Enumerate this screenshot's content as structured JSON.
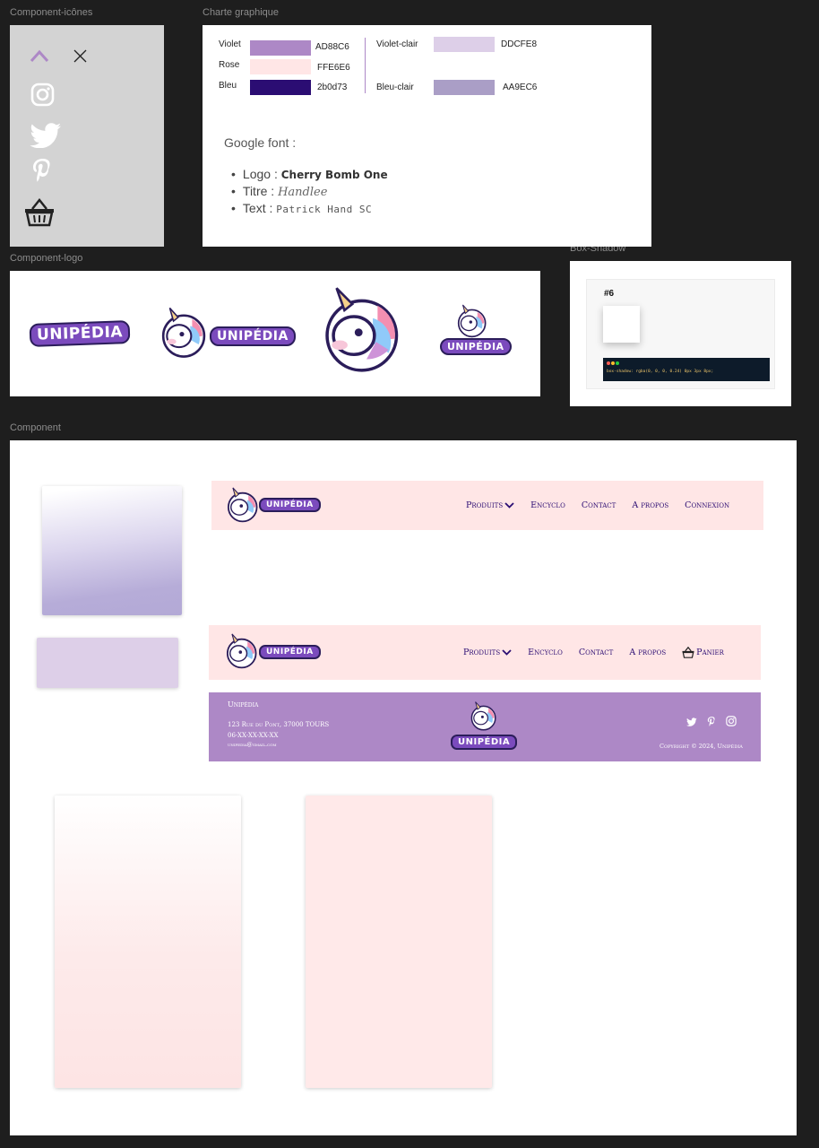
{
  "labels": {
    "icons": "Component-icônes",
    "charte": "Charte graphique",
    "logo": "Component-logo",
    "shadow": "Box-Shadow",
    "component": "Component"
  },
  "icons": [
    "chevron-up-icon",
    "close-icon",
    "instagram-icon",
    "twitter-icon",
    "pinterest-icon",
    "basket-icon"
  ],
  "charte": {
    "colors": [
      {
        "name": "Violet",
        "hex": "AD88C6",
        "color": "#AD88C6"
      },
      {
        "name": "Rose",
        "hex": "FFE6E6",
        "color": "#FFE6E6"
      },
      {
        "name": "Bleu",
        "hex": "2b0d73",
        "color": "#2b0d73"
      },
      {
        "name": "Violet-clair",
        "hex": "DDCFE8",
        "color": "#DDCFE8"
      },
      {
        "name": "Bleu-clair",
        "hex": "AA9EC6",
        "color": "#AA9EC6"
      }
    ],
    "google_font_title": "Google font :",
    "fonts": [
      {
        "label": "Logo :",
        "font": "Cherry Bomb One"
      },
      {
        "label": "Titre :",
        "font": "Handlee"
      },
      {
        "label": "Text :",
        "font": "Patrick Hand SC"
      }
    ]
  },
  "logo": {
    "wordmark": "UNIPÉDIA"
  },
  "shadow": {
    "title": "#6",
    "code": "box-shadow: rgba(0, 0, 0, 0.24) 0px 3px 8px;"
  },
  "nav1": {
    "links": [
      "Produits",
      "Encyclo",
      "Contact",
      "A propos",
      "Connexion"
    ]
  },
  "nav2": {
    "links": [
      "Produits",
      "Encyclo",
      "Contact",
      "A propos"
    ],
    "cart": "Panier"
  },
  "footer": {
    "name": "Unipédia",
    "address": "123 Rue du Pont, 37000 TOURS",
    "phone": "06-XX-XX-XX-XX",
    "email": "unipedia@gmail.com",
    "copyright": "Copyright © 2024, Unipédia"
  }
}
